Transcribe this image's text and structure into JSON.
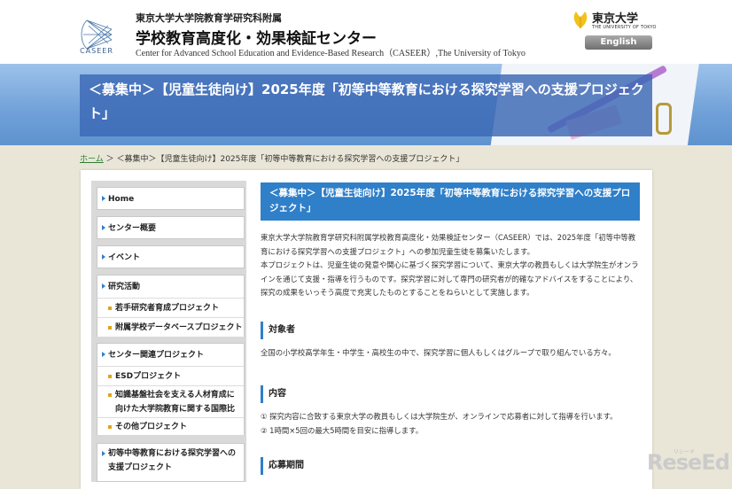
{
  "header": {
    "logo_text": "CASEER",
    "org_line1": "東京大学大学院教育学研究科附属",
    "org_line2": "学校教育高度化・効果検証センター",
    "org_line3": "Center for Advanced School Education and Evidence-Based Research（CASEER）,The University of Tokyo",
    "utokyo_ja": "東京大学",
    "utokyo_en": "THE UNIVERSITY OF TOKYO",
    "english_label": "English"
  },
  "banner": {
    "title": "＜募集中＞【児童生徒向け】2025年度「初等中等教育における探究学習への支援プロジェクト」"
  },
  "breadcrumb": {
    "home": "ホーム",
    "sep": " ＞ ",
    "current": "＜募集中＞【児童生徒向け】2025年度「初等中等教育における探究学習への支援プロジェクト」"
  },
  "sidebar": {
    "items": [
      {
        "label": "Home"
      },
      {
        "label": "センター概要"
      },
      {
        "label": "イベント"
      },
      {
        "label": "研究活動"
      },
      {
        "label": "センター関連プロジェクト"
      },
      {
        "label": "初等中等教育における探究学習への支援プロジェクト"
      }
    ],
    "research_sub": [
      {
        "label": "若手研究者育成プロジェクト"
      },
      {
        "label": "附属学校データベースプロジェクト"
      }
    ],
    "center_sub": [
      {
        "label": "ESDプロジェクト"
      },
      {
        "label": "知識基盤社会を支える人材育成に向けた大学院教育に関する国際比較研究"
      },
      {
        "label": "その他プロジェクト"
      }
    ]
  },
  "main": {
    "title": "＜募集中＞【児童生徒向け】2025年度「初等中等教育における探究学習への支援プロジェクト」",
    "intro1": "東京大学大学院教育学研究科附属学校教育高度化・効果検証センター（CASEER）では、2025年度「初等中等教育における探究学習への支援プロジェクト」への参加児童生徒を募集いたします。",
    "intro2": "本プロジェクトは、児童生徒の発意や関心に基づく探究学習について、東京大学の教員もしくは大学院生がオンラインを通じて支援・指導を行うものです。探究学習に対して専門の研究者が的確なアドバイスをすることにより、探究の成果をいっそう高度で充実したものとすることをねらいとして実施します。",
    "sections": [
      {
        "heading": "対象者",
        "lines": [
          "全国の小学校高学年生・中学生・高校生の中で、探究学習に個人もしくはグループで取り組んでいる方々。"
        ]
      },
      {
        "heading": "内容",
        "lines": [
          "① 探究内容に合致する東京大学の教員もしくは大学院生が、オンラインで応募者に対して指導を行います。",
          "② 1時間×5回の最大5時間を目安に指導します。"
        ]
      },
      {
        "heading": "応募期間",
        "lines": []
      }
    ]
  },
  "watermark": {
    "text": "ReseEd",
    "sub": "リシード"
  }
}
